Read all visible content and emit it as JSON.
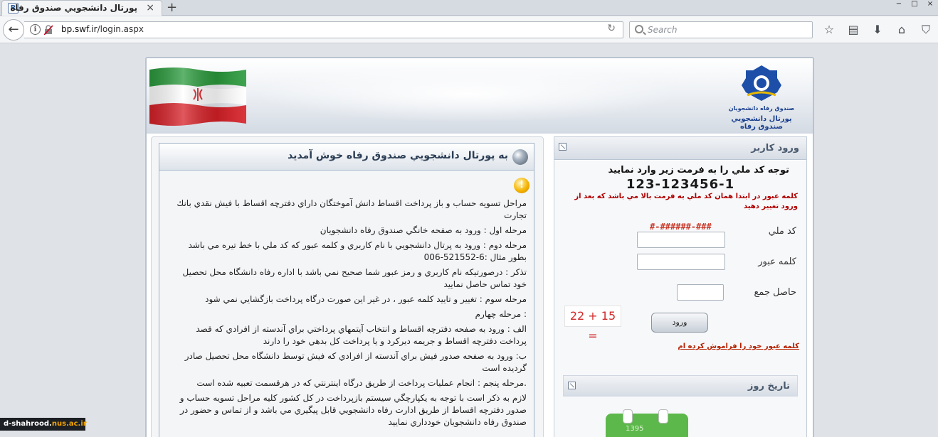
{
  "browser": {
    "tab_title": "پورتال دانشجويي صندوق رفاه",
    "tab_favicon": "R",
    "tab_close": "×",
    "new_tab": "+",
    "window_controls": [
      "−",
      "□",
      "×"
    ],
    "url_domain": "bp.swf.ir",
    "url_path": "/login.aspx",
    "search_placeholder": "Search",
    "toolbar_icons": [
      "star-icon",
      "reading-list-icon",
      "download-icon",
      "home-icon",
      "pocket-icon"
    ]
  },
  "header": {
    "logo_brand": "صندوق رفاه دانشجويان",
    "logo_portal": "پورتال دانشجويي صندوق رفاه"
  },
  "welcome": {
    "title": "به پورتال دانشجويي صندوق رفاه خوش آمديد",
    "paragraphs": [
      "مراحل تسويه حساب و باز پرداخت اقساط دانش آموختگان داراي دفترچه اقساط با فيش نقدي بانك تجارت",
      "مرحله اول : ورود به صفحه خانگي صندوق رفاه دانشجويان",
      "مرحله دوم : ورود به پرتال دانشجويي با نام كاربري و كلمه عبور كه كد ملي با خط تيره مي باشد بطور مثال :6-521552-006",
      "تذكر : درصورتيكه نام كاربري و رمز عبور شما صحيح نمي باشد با اداره رفاه دانشگاه محل تحصيل خود تماس حاصل نماييد",
      "مرحله سوم : تغيير و تاييد كلمه عبور ، در غير اين صورت درگاه پرداخت بازگشايي نمي شود",
      ": مرحله چهارم",
      "الف : ورود به صفحه دفترچه اقساط و انتخاب آيتمهاي پرداختي براي آندسته از افرادي كه قصد پرداخت دفترچه اقساط و جريمه ديركرد و يا پرداخت كل بدهي خود را دارند",
      "ب: ورود به صفحه صدور فيش براي آندسته از افرادي كه فيش توسط دانشگاه محل تحصيل صادر گرديده است",
      ".مرحله پنجم : انجام عمليات پرداخت از طريق درگاه اينترنتي كه در هرقسمت تعبيه شده است",
      "لازم به ذكر است با توجه به يكپارچگي سيستم بازپرداخت در كل كشور كليه مراحل تسويه حساب و صدور دفترچه اقساط از طريق ادارت رفاه دانشجويي قابل پيگيري مي باشد و از تماس و حضور در صندوق رفاه دانشجويان خودداري نماييد"
    ]
  },
  "login": {
    "title": "ورود كاربر",
    "notice": "توجه كد ملي را به فرمت زير وارد نماييد",
    "format_example": "123-123456-1",
    "password_notice": "كلمه عبور  در ابتدا همان كد ملي به  فرمت بالا مي باشد كه بعد از ورود تغيير دهيد",
    "national_id_mask": "#-######-###",
    "national_id_label": "كد ملي",
    "national_id_value": "",
    "password_label": "كلمه عبور",
    "password_value": "",
    "sum_label": "حاصل جمع",
    "sum_value": "",
    "captcha_text": "22 + 15 =",
    "submit_label": "ورود",
    "forgot_label": "كلمه عبور خود را فراموش كرده ام"
  },
  "date_panel": {
    "title": "تاريخ روز",
    "year_fragment": "1395"
  },
  "watermark": {
    "prefix": "d-shahrood.",
    "domain": "nus.ac.ir"
  }
}
